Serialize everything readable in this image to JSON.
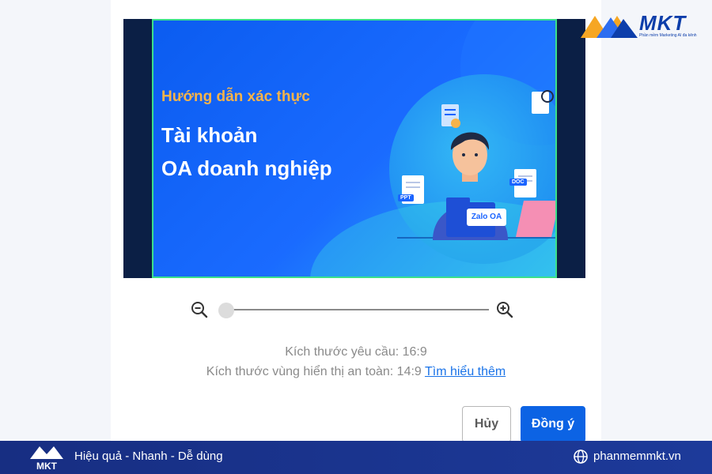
{
  "banner": {
    "subtitle": "Hướng dẫn xác thực",
    "title_line1": "Tài khoản",
    "title_line2": "OA doanh nghiệp",
    "zalo_tag": "Zalo OA",
    "doc_labels": [
      "PPT",
      "DOC"
    ]
  },
  "zoom": {
    "zoom_out_icon": "zoom-out-icon",
    "zoom_in_icon": "zoom-in-icon",
    "level": 0
  },
  "info": {
    "required_size": "Kích thước yêu cầu: 16:9",
    "safe_area": "Kích thước vùng hiển thị an toàn: 14:9",
    "learn_more": "Tìm hiểu thêm"
  },
  "buttons": {
    "cancel": "Hủy",
    "ok": "Đồng ý"
  },
  "brand": {
    "logo_text": "MKT",
    "logo_tagline": "Phần mềm Marketing AI đa kênh",
    "slogan": "Hiệu quả - Nhanh - Dễ dùng",
    "website": "phanmemmkt.vn",
    "globe_icon": "globe-icon"
  },
  "colors": {
    "primary": "#0c63e4",
    "crop_border": "#3ce08a",
    "footer": "#1d3a9a",
    "accent_orange": "#f6b34a"
  }
}
